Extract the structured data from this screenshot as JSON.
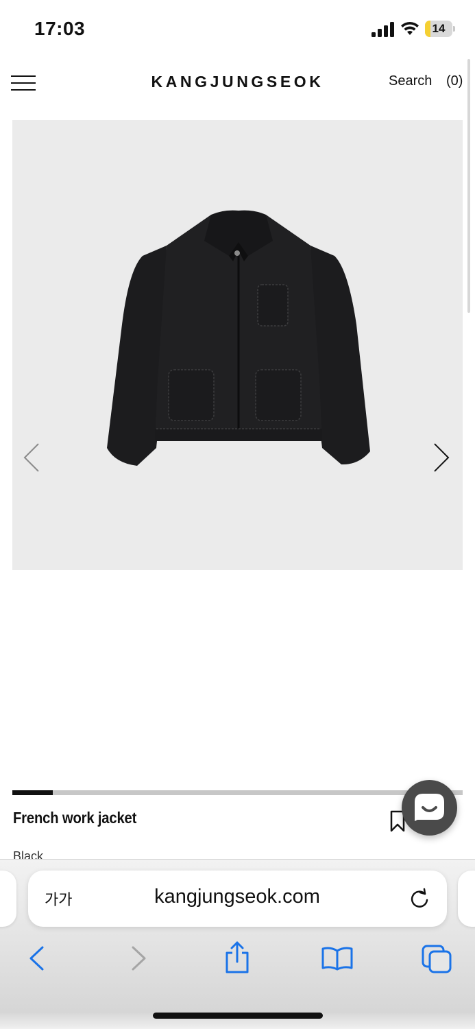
{
  "status_bar": {
    "time": "17:03",
    "battery_level": "14",
    "battery_fraction": 0.14,
    "icons": [
      "cellular-signal-icon",
      "wifi-icon",
      "battery-icon"
    ]
  },
  "header": {
    "brand": "KANGJUNGSEOK",
    "search_label": "Search",
    "cart_count": "(0)",
    "menu_icon": "hamburger-menu-icon"
  },
  "gallery": {
    "image_alt": "jacket-photo",
    "background": "#ebebeb",
    "prev_icon": "chevron-left-icon",
    "next_icon": "chevron-right-icon",
    "progress_fraction": 0.09
  },
  "product": {
    "name": "French work jacket",
    "color": "Black",
    "bookmark_icon": "bookmark-icon"
  },
  "chat": {
    "icon": "chat-bubble-icon",
    "color": "#4a4a4a"
  },
  "browser": {
    "text_size_label": "가가",
    "url": "kangjungseok.com",
    "accent": "#1a73e8",
    "toolbar": [
      "back-icon",
      "forward-icon",
      "share-icon",
      "bookmarks-icon",
      "tabs-icon"
    ]
  }
}
